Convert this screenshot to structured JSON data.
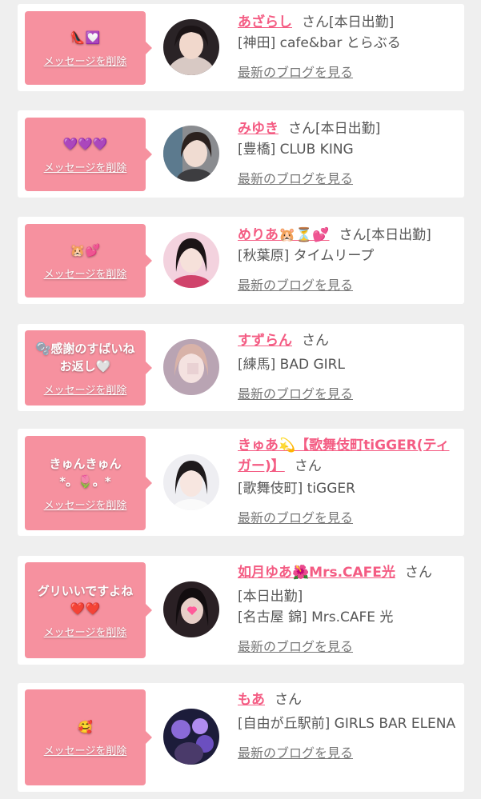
{
  "accent_color": "#f45c83",
  "message_bg_color": "#f6919f",
  "delete_label": "メッセージを削除",
  "blog_label": "最新のブログを見る",
  "san_label": "さん",
  "cards": [
    {
      "message": "👠💟",
      "name": "あざらし",
      "status": "[本日出勤]",
      "shop": "[神田] cafe&bar とらぶる"
    },
    {
      "message": "💜💜💜",
      "name": "みゆき",
      "status": "[本日出勤]",
      "shop": "[豊橋] CLUB KING"
    },
    {
      "message": "🐹💕",
      "name": "めりあ🐹⏳💕",
      "status": "[本日出勤]",
      "shop": "[秋葉原] タイムリープ"
    },
    {
      "message": "🫧感謝のすばいね\nお返し🤍",
      "name": "すずらん",
      "status": "",
      "shop": "[練馬] BAD GIRL"
    },
    {
      "message": "きゅんきゅん\n*。🌷。*",
      "name": "きゅあ💫【歌舞伎町tiGGER(ティガー)】",
      "status": "",
      "shop": "[歌舞伎町] tiGGER"
    },
    {
      "message": "グリいいですよね\n❤️❤️",
      "name": "如月ゆあ🌺Mrs.CAFE光",
      "status": "[本日出勤]",
      "shop": "[名古屋 錦] Mrs.CAFE 光"
    },
    {
      "message": "🥰",
      "name": "もあ",
      "status": "",
      "shop": "[自由が丘駅前] GIRLS BAR ELENA"
    }
  ]
}
